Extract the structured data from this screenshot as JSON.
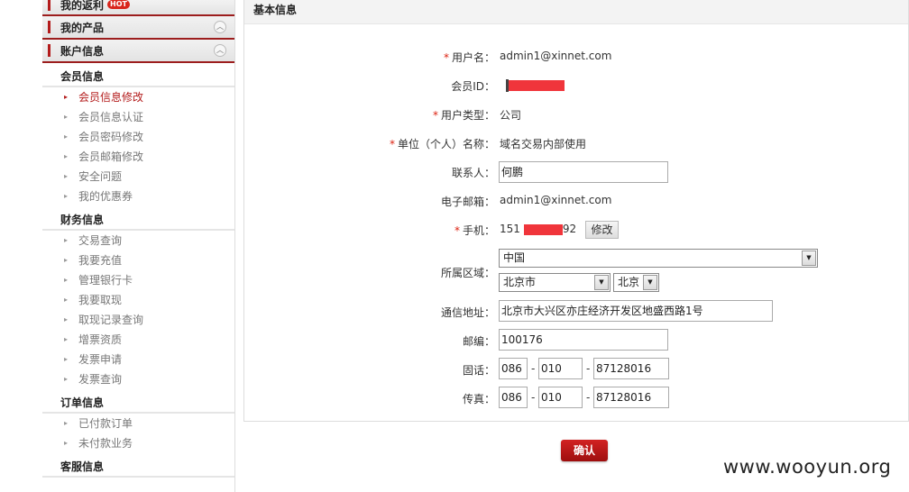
{
  "sidebar": {
    "heads": [
      {
        "label": "我的返利",
        "badge": "HOT"
      },
      {
        "label": "我的产品"
      },
      {
        "label": "账户信息"
      }
    ],
    "groups": [
      {
        "title": "会员信息",
        "items": [
          "会员信息修改",
          "会员信息认证",
          "会员密码修改",
          "会员邮箱修改",
          "安全问题",
          "我的优惠券"
        ]
      },
      {
        "title": "财务信息",
        "items": [
          "交易查询",
          "我要充值",
          "管理银行卡",
          "我要取现",
          "取现记录查询",
          "增票资质",
          "发票申请",
          "发票查询"
        ]
      },
      {
        "title": "订单信息",
        "items": [
          "已付款订单",
          "未付款业务"
        ]
      },
      {
        "title": "客服信息",
        "items": []
      }
    ]
  },
  "panel": {
    "title": "基本信息",
    "fields": {
      "username_label": "用户名：",
      "username": "admin1@xinnet.com",
      "memberid_label": "会员ID：",
      "usertype_label": "用户类型：",
      "usertype": "公司",
      "unitname_label": "单位（个人）名称：",
      "unitname": "域名交易内部使用",
      "contact_label": "联系人：",
      "contact": "何鹏",
      "email_label": "电子邮箱：",
      "email": "admin1@xinnet.com",
      "mobile_label": "手机：",
      "mobile_prefix": "151",
      "mobile_suffix": "92",
      "edit_button": "修改",
      "region_label": "所属区域：",
      "country": "中国",
      "city": "北京市",
      "district": "北京",
      "address_label": "通信地址：",
      "address": "北京市大兴区亦庄经济开发区地盛西路1号",
      "zip_label": "邮编：",
      "zip": "100176",
      "phone_label": "固话：",
      "phone_country": "086",
      "phone_area": "010",
      "phone_number": "87128016",
      "fax_label": "传真：",
      "fax_country": "086",
      "fax_area": "010",
      "fax_number": "87128016",
      "dash": "-",
      "required_mark": "*"
    },
    "confirm_button": "确认"
  },
  "watermark": "www.wooyun.org",
  "colors": {
    "accent": "#b31b1b",
    "redaction": "#f0353b"
  }
}
